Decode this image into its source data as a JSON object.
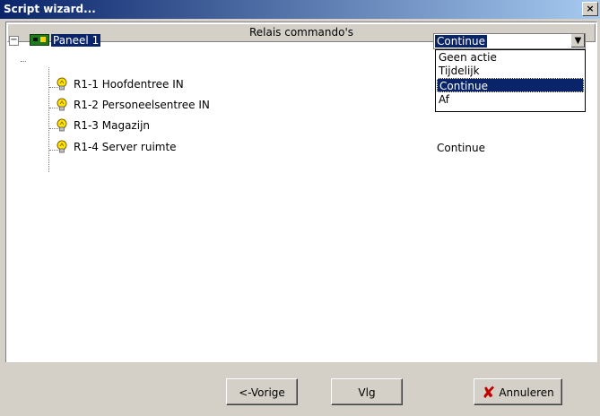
{
  "window": {
    "title": "Script wizard...",
    "close_glyph": "×"
  },
  "header": {
    "column_title": "Relais commando's"
  },
  "tree": {
    "expander_glyph": "−",
    "root": {
      "label": "Paneel 1",
      "icon": "circuit-board-icon",
      "value": "Continue"
    },
    "items": [
      {
        "label": "R1-1 Hoofdentree IN",
        "icon": "lightbulb-icon",
        "value": ""
      },
      {
        "label": "R1-2 Personeelsentree IN",
        "icon": "lightbulb-icon",
        "value": ""
      },
      {
        "label": "R1-3 Magazijn",
        "icon": "lightbulb-icon",
        "value": ""
      },
      {
        "label": "R1-4 Server ruimte",
        "icon": "lightbulb-icon",
        "value": "Continue"
      }
    ]
  },
  "combo": {
    "selected": "Continue",
    "arrow_glyph": "▼",
    "options": [
      "Geen actie",
      "Tijdelijk",
      "Continue",
      "Af"
    ]
  },
  "buttons": {
    "previous": "<-Vorige",
    "next": "Vlg",
    "cancel": "Annuleren",
    "cancel_icon_glyph": "✘"
  },
  "colors": {
    "selection": "#0a246a",
    "face": "#d4d0c8"
  }
}
